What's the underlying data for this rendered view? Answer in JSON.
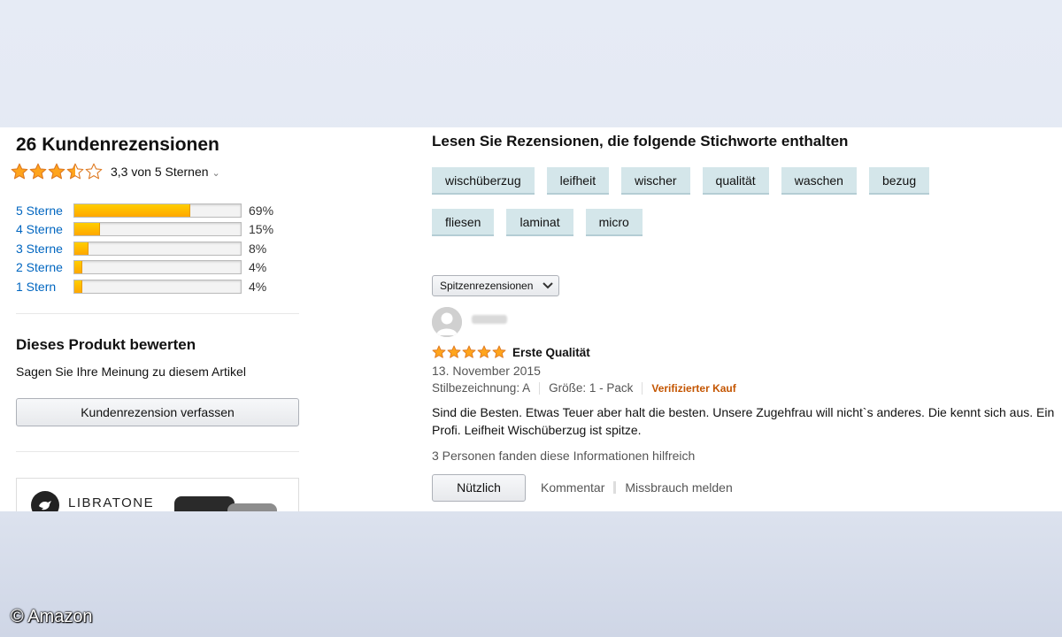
{
  "summary": {
    "title": "26 Kundenrezensionen",
    "average_text": "3,3 von 5 Sternen",
    "average_rating": 3.3,
    "histogram": [
      {
        "label": "5 Sterne",
        "percent_text": "69%",
        "percent": 69
      },
      {
        "label": "4 Sterne",
        "percent_text": "15%",
        "percent": 15
      },
      {
        "label": "3 Sterne",
        "percent_text": "8%",
        "percent": 8
      },
      {
        "label": "2 Sterne",
        "percent_text": "4%",
        "percent": 4
      },
      {
        "label": "1 Stern",
        "percent_text": "4%",
        "percent": 4
      }
    ]
  },
  "rate": {
    "title": "Dieses Produkt bewerten",
    "subtitle": "Sagen Sie Ihre Meinung zu diesem Artikel",
    "button": "Kundenrezension verfassen"
  },
  "ad": {
    "brand": "LIBRATONE"
  },
  "keywords": {
    "title": "Lesen Sie Rezensionen, die folgende Stichworte enthalten",
    "row1": [
      "wischüberzug",
      "leifheit",
      "wischer",
      "qualität",
      "waschen",
      "bezug"
    ],
    "row2": [
      "fliesen",
      "laminat",
      "micro"
    ]
  },
  "sort": {
    "selected": "Spitzenrezensionen"
  },
  "review": {
    "rating": 5,
    "title": "Erste Qualität",
    "date": "13. November 2015",
    "style": "Stilbezeichnung: A",
    "size": "Größe: 1 - Pack",
    "verified": "Verifizierter Kauf",
    "body": "Sind die Besten. Etwas Teuer aber halt die besten. Unsere Zugehfrau will nicht`s anderes. Die kennt sich aus. Ein Profi. Leifheit Wischüberzug ist spitze.",
    "helpful": "3 Personen fanden diese Informationen hilfreich",
    "useful_button": "Nützlich",
    "comment": "Kommentar",
    "report": "Missbrauch melden"
  },
  "credit": "© Amazon",
  "colors": {
    "star": "#ffa41c",
    "link": "#0066c0",
    "verified": "#c45500",
    "chip": "#d4e6ea"
  }
}
